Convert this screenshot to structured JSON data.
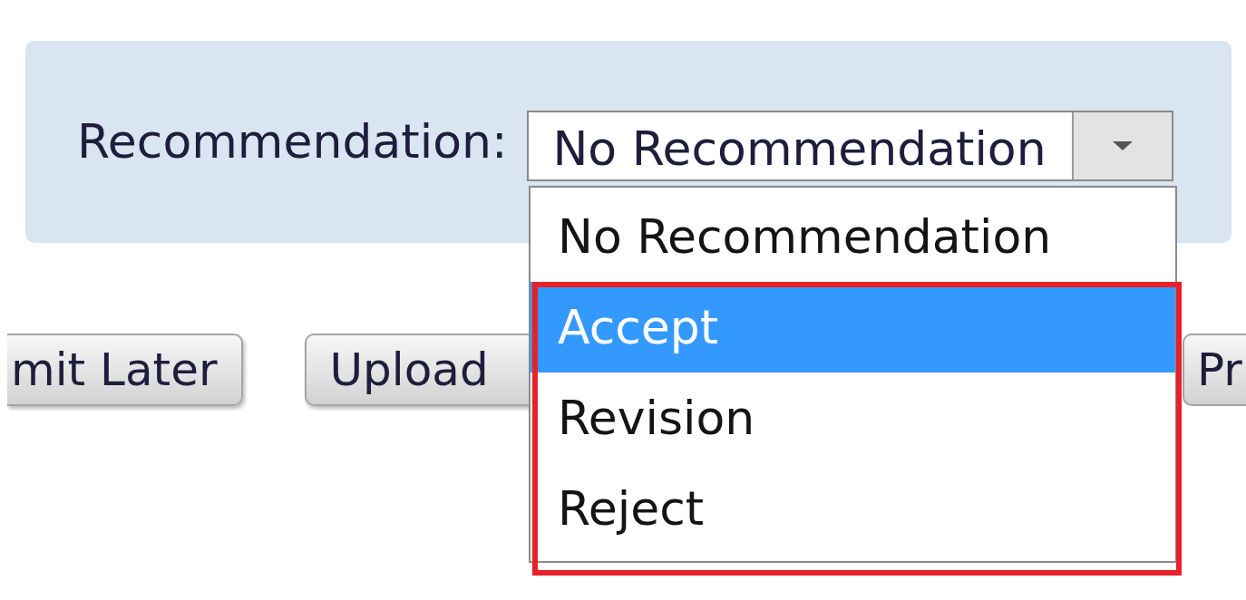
{
  "field": {
    "label": "Recommendation:",
    "value": "No Recommendation",
    "expanded": true
  },
  "options": [
    {
      "label": "No Recommendation",
      "selected": false
    },
    {
      "label": "Accept",
      "selected": true
    },
    {
      "label": "Revision",
      "selected": false
    },
    {
      "label": "Reject",
      "selected": false
    }
  ],
  "buttons": [
    "mit Later",
    "Upload",
    "Pr"
  ]
}
